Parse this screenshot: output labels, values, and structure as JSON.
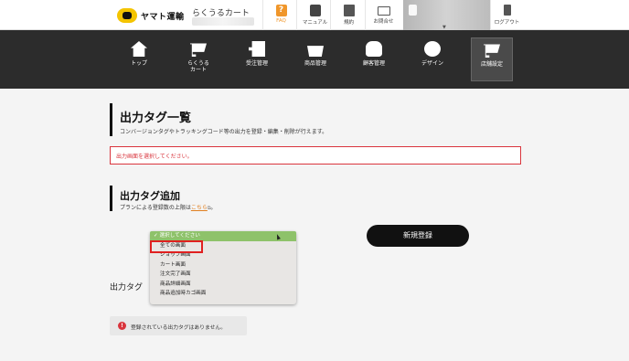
{
  "header": {
    "logo_text": "ヤマト運輸",
    "cart_name": "らくうるカート",
    "icons": [
      {
        "label": "FAQ",
        "icon": "faq-icon",
        "color": "#f0962a"
      },
      {
        "label": "マニュアル",
        "icon": "manual-icon"
      },
      {
        "label": "規約",
        "icon": "terms-icon"
      },
      {
        "label": "お問合せ",
        "icon": "mail-icon"
      }
    ],
    "logout_label": "ログアウト"
  },
  "nav": {
    "items": [
      {
        "label": "トップ",
        "icon": "home-icon"
      },
      {
        "label": "らくうる\nカート",
        "icon": "cart-icon"
      },
      {
        "label": "受注管理",
        "icon": "orders-icon"
      },
      {
        "label": "商品管理",
        "icon": "basket-icon"
      },
      {
        "label": "顧客管理",
        "icon": "customers-icon"
      },
      {
        "label": "デザイン",
        "icon": "palette-icon"
      },
      {
        "label": "店舗設定",
        "icon": "shop-settings-icon",
        "active": true
      }
    ]
  },
  "section1": {
    "title": "出力タグ一覧",
    "description": "コンバージョンタグやトラッキングコード等の出力を登録・編集・削除が行えます。",
    "error": "出力画面を選択してください。"
  },
  "section2": {
    "title": "出力タグ追加",
    "description_prefix": "プランによる登録数の上限は",
    "link_text": "こちら",
    "description_suffix": "。",
    "new_button": "新規登録"
  },
  "dropdown": {
    "options": [
      "✓ 選択してください",
      "全ての画面",
      "ショップ画面",
      "カート画面",
      "注文完了画面",
      "商品詳細画面",
      "商品追加時カゴ画面"
    ],
    "selected_index": 0,
    "highlighted_index": 1
  },
  "output_label": "出力タグ",
  "info": {
    "icon": "!",
    "text": "登録されている出力タグはありません。"
  },
  "colors": {
    "nav_bg": "#2c2c2c",
    "error": "#d9353d",
    "accent_orange": "#e07f1f",
    "selected_option": "#8ec26a"
  }
}
